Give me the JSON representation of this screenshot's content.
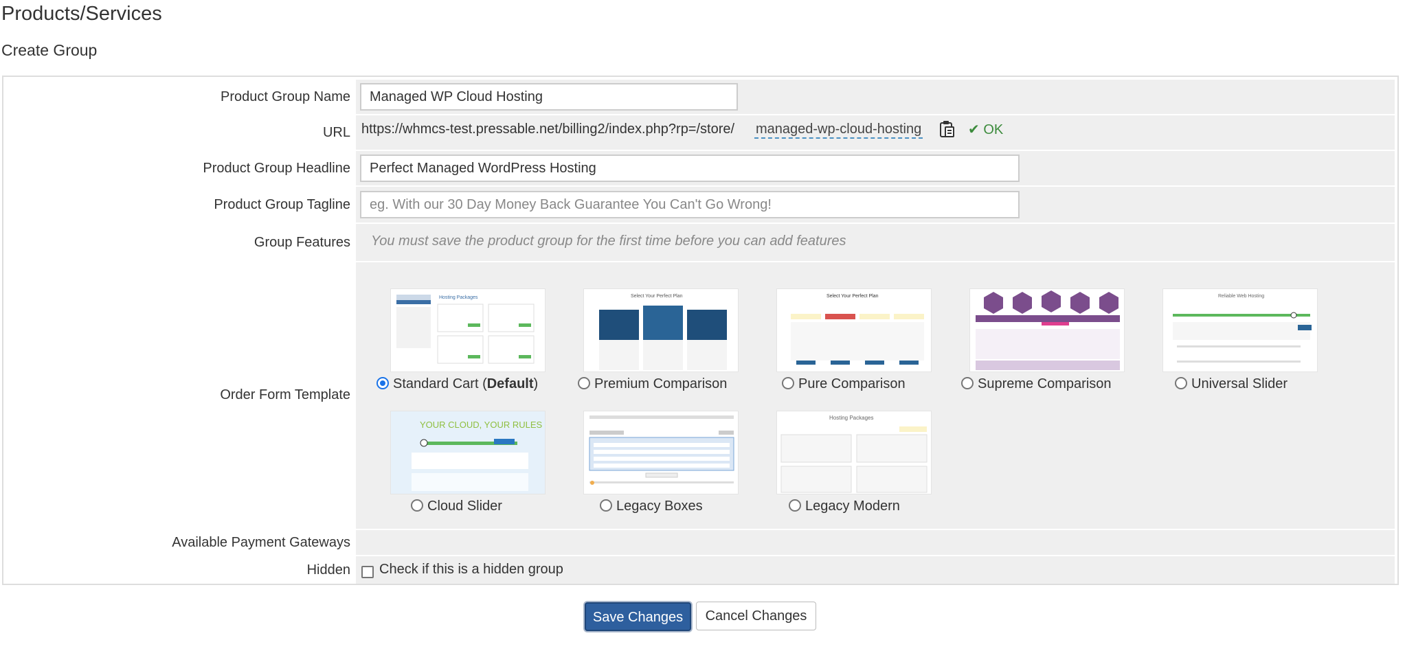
{
  "header": {
    "title": "Products/Services",
    "subtitle": "Create Group"
  },
  "form": {
    "group_name": {
      "label": "Product Group Name",
      "value": "Managed WP Cloud Hosting"
    },
    "url": {
      "label": "URL",
      "prefix": "https://whmcs-test.pressable.net/billing2/index.php?rp=/store/",
      "slug": "managed-wp-cloud-hosting",
      "status": "OK",
      "status_color": "#3c8b3c"
    },
    "headline": {
      "label": "Product Group Headline",
      "value": "Perfect Managed WordPress Hosting"
    },
    "tagline": {
      "label": "Product Group Tagline",
      "value": "",
      "placeholder": "eg. With our 30 Day Money Back Guarantee You Can't Go Wrong!"
    },
    "features": {
      "label": "Group Features",
      "note": "You must save the product group for the first time before you can add features"
    },
    "order_form": {
      "label": "Order Form Template",
      "templates": [
        {
          "name": "Standard Cart (",
          "bold": "Default",
          "suffix": ")",
          "selected": true
        },
        {
          "name": "Premium Comparison",
          "selected": false
        },
        {
          "name": "Pure Comparison",
          "selected": false
        },
        {
          "name": "Supreme Comparison",
          "selected": false
        },
        {
          "name": "Universal Slider",
          "selected": false
        },
        {
          "name": "Cloud Slider",
          "selected": false
        },
        {
          "name": "Legacy Boxes",
          "selected": false
        },
        {
          "name": "Legacy Modern",
          "selected": false
        }
      ]
    },
    "payment_gateways": {
      "label": "Available Payment Gateways"
    },
    "hidden": {
      "label": "Hidden",
      "checkbox_text": "Check if this is a hidden group",
      "checked": false
    }
  },
  "buttons": {
    "save": "Save Changes",
    "cancel": "Cancel Changes"
  },
  "colors": {
    "accent": "#2e5f9e",
    "field_bg": "#efefef",
    "border": "#dddddd"
  }
}
